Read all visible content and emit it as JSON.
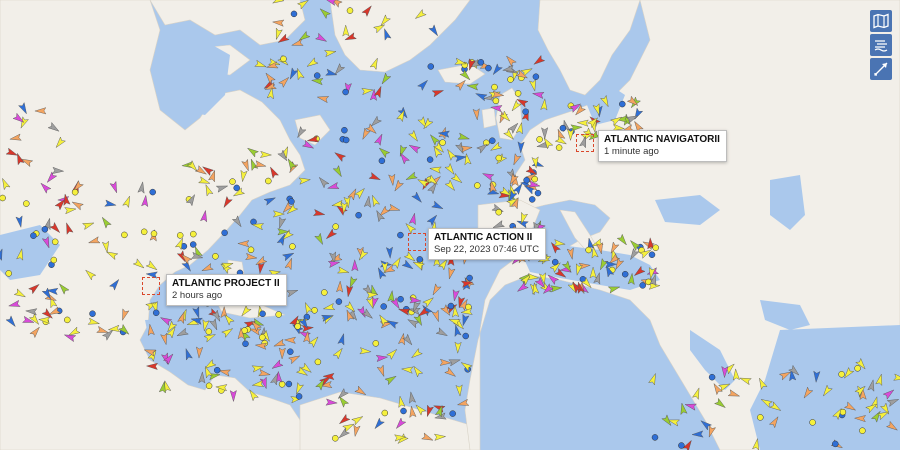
{
  "labels": [
    {
      "name": "ATLANTIC NAVIGATORII",
      "time": "1 minute ago"
    },
    {
      "name": "ATLANTIC ACTION II",
      "time": "Sep 22, 2023 07:46 UTC"
    },
    {
      "name": "ATLANTIC PROJECT II",
      "time": "2 hours ago"
    }
  ],
  "toolbar": {
    "icons": [
      "map-layers-icon",
      "weather-wind-icon",
      "measure-distance-icon"
    ]
  },
  "colors": {
    "sea": "#aac8ec",
    "land": "#f2efe9",
    "cargo": "#9acd32",
    "tanker": "#d9372b",
    "passenger": "#2f6fd6",
    "fishing": "#f4a460",
    "pleasure": "#d94ad9",
    "unknown": "#9e9e9e",
    "other": "#f5f03c",
    "selection": "#d9472b",
    "toolbar": "#4a74b3"
  }
}
